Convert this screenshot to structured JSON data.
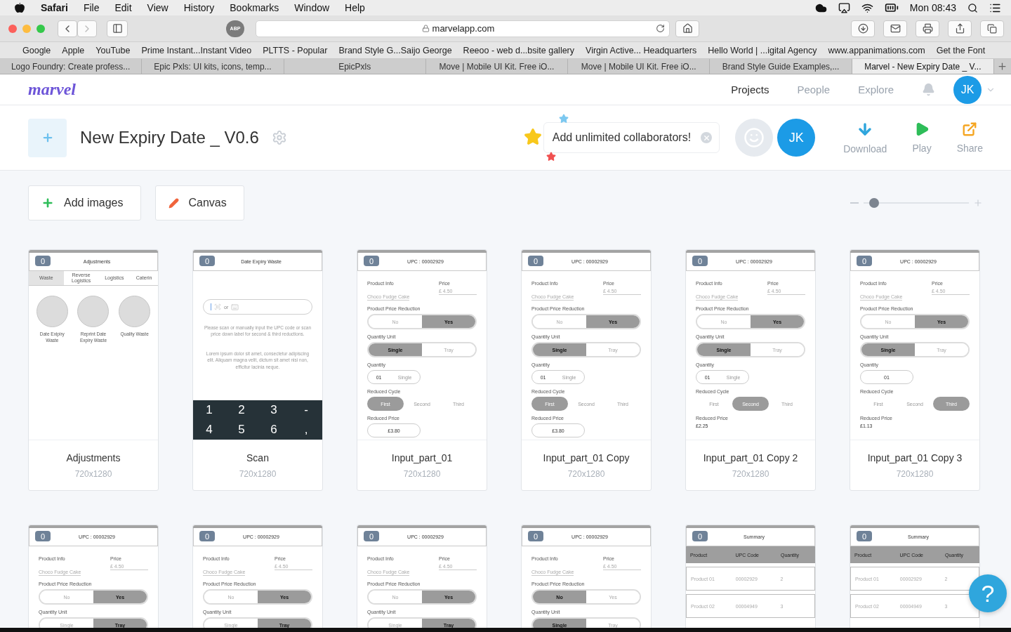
{
  "menubar": {
    "app": "Safari",
    "menus": [
      "File",
      "Edit",
      "View",
      "History",
      "Bookmarks",
      "Window",
      "Help"
    ],
    "clock": "Mon 08:43"
  },
  "browser": {
    "adblock": "ABP",
    "address": "marvelapp.com",
    "bookmarks": [
      "Google",
      "Apple",
      "YouTube",
      "Prime Instant...Instant Video",
      "PLTTS - Popular",
      "Brand Style G...Saijo George",
      "Reeoo - web d...bsite gallery",
      "Virgin Active... Headquarters",
      "Hello World | ...igital Agency",
      "www.appanimations.com",
      "Get the Font"
    ],
    "tabs": [
      {
        "title": "Logo Foundry: Create profess...",
        "selected": false
      },
      {
        "title": "Epic Pxls: UI kits, icons, temp...",
        "selected": false
      },
      {
        "title": "EpicPxls",
        "selected": false
      },
      {
        "title": "Move | Mobile UI Kit. Free iO...",
        "selected": false
      },
      {
        "title": "Move | Mobile UI Kit. Free iO...",
        "selected": false
      },
      {
        "title": "Brand Style Guide Examples,...",
        "selected": false
      },
      {
        "title": "Marvel - New Expiry Date _ V...",
        "selected": true
      }
    ]
  },
  "nav": {
    "logo": "marvel",
    "items": [
      {
        "label": "Projects",
        "selected": true
      },
      {
        "label": "People",
        "selected": false
      },
      {
        "label": "Explore",
        "selected": false
      }
    ],
    "avatar": "JK"
  },
  "project": {
    "title": "New Expiry Date _ V0.6",
    "promo": "Add unlimited collaborators!",
    "collaborator": "JK",
    "actions": [
      {
        "label": "Download",
        "kind": "download"
      },
      {
        "label": "Play",
        "kind": "play"
      },
      {
        "label": "Share",
        "kind": "share"
      }
    ]
  },
  "tools": [
    {
      "label": "Add images",
      "kind": "add"
    },
    {
      "label": "Canvas",
      "kind": "canvas"
    }
  ],
  "zoom": {
    "level": 0.1
  },
  "screens": [
    {
      "name": "Adjustments",
      "size": "720x1280",
      "comments": "0",
      "mockup": {
        "kind": "menu",
        "title": "Adjustments",
        "tabs": [
          {
            "label": "Waste",
            "selected": true
          },
          {
            "label": "Reverse Logistics",
            "selected": false
          },
          {
            "label": "Logistics",
            "selected": false
          },
          {
            "label": "Caterin",
            "selected": false
          }
        ],
        "tiles": [
          "Date Exipiry Waste",
          "Reprint Date Expiry Waste",
          "Quality Waste"
        ]
      }
    },
    {
      "name": "Scan",
      "size": "720x1280",
      "comments": "0",
      "mockup": {
        "kind": "scan",
        "title": "Date Expiry Waste",
        "input_hint": "or",
        "instructions": "Please scan or manually input the UPC code or scan price down label for second & third reductions.",
        "body": "Lorem ipsum dolor sit amet, consectetur adipiscing elit. Aliquam magna velit, dictum sit amet nisi non, efficitur lacinia neque.",
        "keys": [
          "1",
          "2",
          "3",
          "-",
          "4",
          "5",
          "6",
          ","
        ]
      }
    },
    {
      "name": "Input_part_01",
      "size": "720x1280",
      "comments": "0",
      "mockup": {
        "kind": "form",
        "title": "UPC : 00002929",
        "sections": [
          {
            "kind": "info",
            "label": "Product Info",
            "value": "Choco Fudge Cake",
            "price_label": "Price",
            "price": "£ 4.50"
          },
          {
            "kind": "toggle",
            "label": "Product Price Reduction",
            "options": [
              {
                "label": "No",
                "selected": false
              },
              {
                "label": "Yes",
                "selected": true
              }
            ]
          },
          {
            "kind": "toggle",
            "label": "Quantity Unit",
            "options": [
              {
                "label": "Single",
                "selected": true
              },
              {
                "label": "Tray",
                "selected": false
              }
            ]
          },
          {
            "kind": "quantity",
            "label": "Quantity",
            "value": "01",
            "unit": "Single"
          },
          {
            "kind": "cycle",
            "label": "Reduced Cycle",
            "options": [
              {
                "label": "First",
                "selected": true
              },
              {
                "label": "Second",
                "selected": false
              },
              {
                "label": "Third",
                "selected": false
              }
            ]
          },
          {
            "kind": "price",
            "label": "Reduced Price",
            "value": "£3.80",
            "boxed": true
          }
        ]
      }
    },
    {
      "name": "Input_part_01 Copy",
      "size": "720x1280",
      "comments": "0",
      "mockup": {
        "kind": "form",
        "title": "UPC : 00002929",
        "sections": [
          {
            "kind": "info",
            "label": "Product Info",
            "value": "Choco Fudge Cake",
            "price_label": "Price",
            "price": "£ 4.50"
          },
          {
            "kind": "toggle",
            "label": "Product Price Reduction",
            "options": [
              {
                "label": "No",
                "selected": false
              },
              {
                "label": "Yes",
                "selected": true
              }
            ]
          },
          {
            "kind": "toggle",
            "label": "Quantity Unit",
            "options": [
              {
                "label": "Single",
                "selected": true
              },
              {
                "label": "Tray",
                "selected": false
              }
            ]
          },
          {
            "kind": "quantity",
            "label": "Quantity",
            "value": "01",
            "unit": "Single"
          },
          {
            "kind": "cycle",
            "label": "Reduced Cycle",
            "options": [
              {
                "label": "First",
                "selected": true
              },
              {
                "label": "Second",
                "selected": false
              },
              {
                "label": "Third",
                "selected": false
              }
            ]
          },
          {
            "kind": "price",
            "label": "Reduced Price",
            "value": "£3.80",
            "boxed": true
          }
        ]
      }
    },
    {
      "name": "Input_part_01 Copy 2",
      "size": "720x1280",
      "comments": "0",
      "mockup": {
        "kind": "form",
        "title": "UPC : 00002929",
        "sections": [
          {
            "kind": "info",
            "label": "Product Info",
            "value": "Choco Fudge Cake",
            "price_label": "Price",
            "price": "£ 4.50"
          },
          {
            "kind": "toggle",
            "label": "Product Price Reduction",
            "options": [
              {
                "label": "No",
                "selected": false
              },
              {
                "label": "Yes",
                "selected": true
              }
            ]
          },
          {
            "kind": "toggle",
            "label": "Quantity Unit",
            "options": [
              {
                "label": "Single",
                "selected": true
              },
              {
                "label": "Tray",
                "selected": false
              }
            ]
          },
          {
            "kind": "quantity",
            "label": "Quantity",
            "value": "01",
            "unit": "Single"
          },
          {
            "kind": "cycle",
            "label": "Reduced Cycle",
            "options": [
              {
                "label": "First",
                "selected": false
              },
              {
                "label": "Second",
                "selected": true
              },
              {
                "label": "Third",
                "selected": false
              }
            ]
          },
          {
            "kind": "price",
            "label": "Reduced Price",
            "value": "£2.25",
            "boxed": false
          }
        ]
      }
    },
    {
      "name": "Input_part_01 Copy 3",
      "size": "720x1280",
      "comments": "0",
      "mockup": {
        "kind": "form",
        "title": "UPC : 00002929",
        "sections": [
          {
            "kind": "info",
            "label": "Product Info",
            "value": "Choco Fudge Cake",
            "price_label": "Price",
            "price": "£ 4.50"
          },
          {
            "kind": "toggle",
            "label": "Product Price Reduction",
            "options": [
              {
                "label": "No",
                "selected": false
              },
              {
                "label": "Yes",
                "selected": true
              }
            ]
          },
          {
            "kind": "toggle",
            "label": "Quantity Unit",
            "options": [
              {
                "label": "Single",
                "selected": true
              },
              {
                "label": "Tray",
                "selected": false
              }
            ]
          },
          {
            "kind": "quantity",
            "label": "Quantity",
            "value": "01"
          },
          {
            "kind": "cycle",
            "label": "Reduced Cycle",
            "options": [
              {
                "label": "First",
                "selected": false
              },
              {
                "label": "Second",
                "selected": false
              },
              {
                "label": "Third",
                "selected": true
              }
            ]
          },
          {
            "kind": "price",
            "label": "Reduced Price",
            "value": "£1.13",
            "boxed": false
          }
        ]
      }
    },
    {
      "comments": "0",
      "mockup": {
        "kind": "form",
        "title": "UPC : 00002929",
        "sections": [
          {
            "kind": "info",
            "label": "Product Info",
            "value": "Choco Fudge Cake",
            "price_label": "Price",
            "price": "£ 4.50"
          },
          {
            "kind": "toggle",
            "label": "Product Price Reduction",
            "options": [
              {
                "label": "No",
                "selected": false
              },
              {
                "label": "Yes",
                "selected": true
              }
            ]
          },
          {
            "kind": "toggle",
            "label": "Quantity Unit",
            "options": [
              {
                "label": "Single",
                "selected": false
              },
              {
                "label": "Tray",
                "selected": true
              }
            ]
          }
        ]
      }
    },
    {
      "comments": "0",
      "mockup": {
        "kind": "form",
        "title": "UPC : 00002929",
        "sections": [
          {
            "kind": "info",
            "label": "Product Info",
            "value": "Choco Fudge Cake",
            "price_label": "Price",
            "price": "£ 4.50"
          },
          {
            "kind": "toggle",
            "label": "Product Price Reduction",
            "options": [
              {
                "label": "No",
                "selected": false
              },
              {
                "label": "Yes",
                "selected": true
              }
            ]
          },
          {
            "kind": "toggle",
            "label": "Quantity Unit",
            "options": [
              {
                "label": "Single",
                "selected": false
              },
              {
                "label": "Tray",
                "selected": true
              }
            ]
          }
        ]
      }
    },
    {
      "comments": "0",
      "mockup": {
        "kind": "form",
        "title": "UPC : 00002929",
        "sections": [
          {
            "kind": "info",
            "label": "Product Info",
            "value": "Choco Fudge Cake",
            "price_label": "Price",
            "price": "£ 4.50"
          },
          {
            "kind": "toggle",
            "label": "Product Price Reduction",
            "options": [
              {
                "label": "No",
                "selected": false
              },
              {
                "label": "Yes",
                "selected": true
              }
            ]
          },
          {
            "kind": "toggle",
            "label": "Quantity Unit",
            "options": [
              {
                "label": "Single",
                "selected": false
              },
              {
                "label": "Tray",
                "selected": true
              }
            ]
          }
        ]
      }
    },
    {
      "comments": "0",
      "mockup": {
        "kind": "form",
        "title": "UPC : 00002929",
        "sections": [
          {
            "kind": "info",
            "label": "Product Info",
            "value": "Choco Fudge Cake",
            "price_label": "Price",
            "price": "£ 4.50"
          },
          {
            "kind": "toggle",
            "label": "Product Price Reduction",
            "options": [
              {
                "label": "No",
                "selected": true
              },
              {
                "label": "Yes",
                "selected": false
              }
            ]
          },
          {
            "kind": "toggle",
            "label": "Quantity Unit",
            "options": [
              {
                "label": "Single",
                "selected": true
              },
              {
                "label": "Tray",
                "selected": false
              }
            ]
          }
        ]
      }
    },
    {
      "comments": "0",
      "mockup": {
        "kind": "summary",
        "title": "Summary",
        "columns": [
          "Product",
          "UPC Code",
          "Quantity"
        ],
        "rows": [
          [
            "Product 01",
            "00002929",
            "2"
          ],
          [
            "Product 02",
            "00004949",
            "3"
          ]
        ]
      }
    },
    {
      "comments": "0",
      "mockup": {
        "kind": "summary",
        "title": "Summary",
        "columns": [
          "Product",
          "UPC Code",
          "Quantity"
        ],
        "rows": [
          [
            "Product 01",
            "00002929",
            "2"
          ],
          [
            "Product 02",
            "00004949",
            "3"
          ]
        ]
      }
    }
  ],
  "help": "?"
}
